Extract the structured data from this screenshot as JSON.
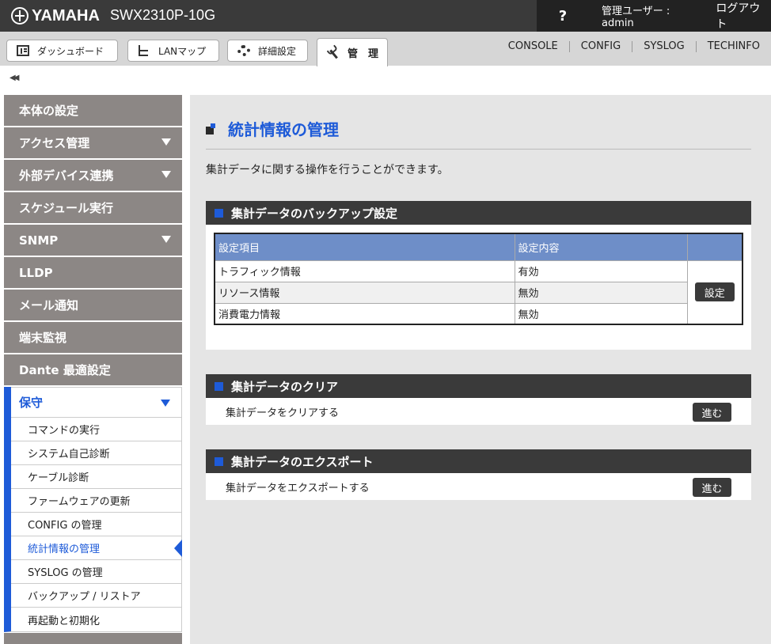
{
  "header": {
    "brand": "YAMAHA",
    "model": "SWX2310P-10G",
    "help": "?",
    "user_label": "管理ユーザー : admin",
    "logout": "ログアウト"
  },
  "tabs": [
    {
      "label": "ダッシュボード",
      "icon": "dashboard-icon"
    },
    {
      "label": "LANマップ",
      "icon": "lan-map-icon"
    },
    {
      "label": "詳細設定",
      "icon": "gear-icon"
    },
    {
      "label": "管　理",
      "icon": "wrench-icon",
      "active": true
    }
  ],
  "toplinks": [
    "CONSOLE",
    "CONFIG",
    "SYSLOG",
    "TECHINFO"
  ],
  "sidebar": {
    "collapse": "◀◀",
    "items": [
      {
        "label": "本体の設定",
        "has_arrow": false
      },
      {
        "label": "アクセス管理",
        "has_arrow": true
      },
      {
        "label": "外部デバイス連携",
        "has_arrow": true
      },
      {
        "label": "スケジュール実行",
        "has_arrow": false
      },
      {
        "label": "SNMP",
        "has_arrow": true
      },
      {
        "label": "LLDP",
        "has_arrow": false
      },
      {
        "label": "メール通知",
        "has_arrow": false
      },
      {
        "label": "端末監視",
        "has_arrow": false
      },
      {
        "label": "Dante 最適設定",
        "has_arrow": false
      }
    ],
    "open_section": {
      "label": "保守",
      "items": [
        "コマンドの実行",
        "システム自己診断",
        "ケーブル診断",
        "ファームウェアの更新",
        "CONFIG の管理",
        "統計情報の管理",
        "SYSLOG の管理",
        "バックアップ / リストア",
        "再起動と初期化"
      ],
      "active_item": "統計情報の管理"
    }
  },
  "main": {
    "title": "統計情報の管理",
    "description": "集計データに関する操作を行うことができます。",
    "backup": {
      "heading": "集計データのバックアップ設定",
      "columns": [
        "設定項目",
        "設定内容"
      ],
      "rows": [
        {
          "item": "トラフィック情報",
          "value": "有効"
        },
        {
          "item": "リソース情報",
          "value": "無効"
        },
        {
          "item": "消費電力情報",
          "value": "無効"
        }
      ],
      "button": "設定"
    },
    "clear": {
      "heading": "集計データのクリア",
      "label": "集計データをクリアする",
      "button": "進む"
    },
    "export": {
      "heading": "集計データのエクスポート",
      "label": "集計データをエクスポートする",
      "button": "進む"
    }
  },
  "colors": {
    "accent": "#1e5bd8",
    "header_bg": "#3a3a3a",
    "sidebar_bg": "#8c8785",
    "table_header": "#6e8ec8"
  }
}
